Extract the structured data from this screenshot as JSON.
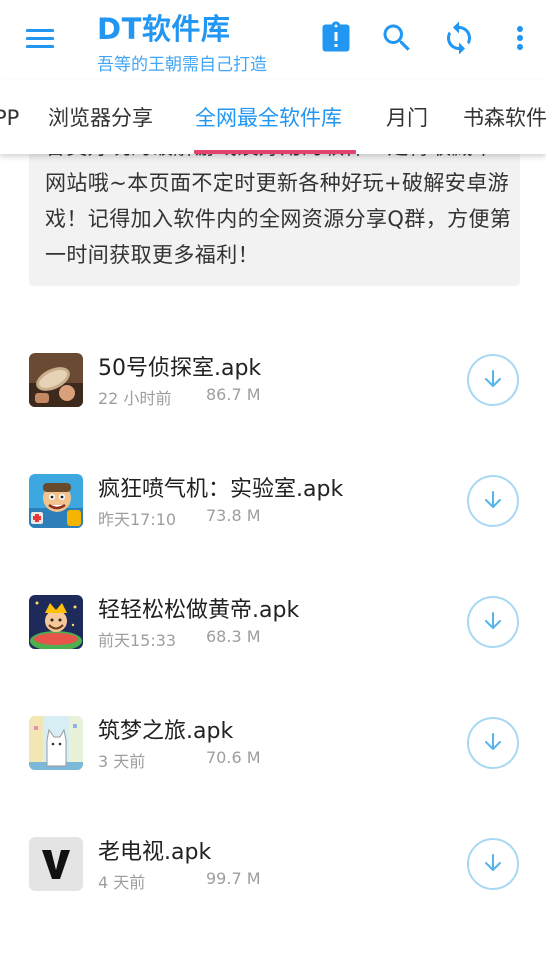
{
  "colors": {
    "primary": "#2196F3",
    "tab_indicator": "#E0436E",
    "download_circle": "#A8D8F3",
    "notice_bg": "#F2F2F2",
    "meta_text": "#9E9E9E"
  },
  "app_bar": {
    "title": "DT软件库",
    "subtitle": "吾等的王朝需自己打造",
    "icons": [
      "menu-icon",
      "clipboard-alert-icon",
      "search-icon",
      "refresh-icon",
      "more-vert-icon"
    ]
  },
  "tabs": [
    {
      "label": "PP",
      "active": false
    },
    {
      "label": "浏览器分享",
      "active": false
    },
    {
      "label": "全网最全软件库",
      "active": true
    },
    {
      "label": "月门",
      "active": false
    },
    {
      "label": "书森软件",
      "active": false
    }
  ],
  "notice": {
    "text": "各类好玩的破解游戏及好用的软件一定得收藏本网站哦~本页面不定时更新各种好玩+破解安卓游戏！记得加入软件内的全网资源分享Q群，方便第一时间获取更多福利！"
  },
  "files": [
    {
      "name": "50号侦探室.apk",
      "time": "22 小时前",
      "size": "86.7 M",
      "icon": "detective-game-icon"
    },
    {
      "name": "疯狂喷气机：实验室.apk",
      "time": "昨天17:10",
      "size": "73.8 M",
      "icon": "jetpack-game-icon"
    },
    {
      "name": "轻轻松松做黄帝.apk",
      "time": "前天15:33",
      "size": "68.3 M",
      "icon": "emperor-game-icon"
    },
    {
      "name": "筑梦之旅.apk",
      "time": "3 天前",
      "size": "70.6 M",
      "icon": "cat-game-icon"
    },
    {
      "name": "老电视.apk",
      "time": "4 天前",
      "size": "99.7 M",
      "icon": "v-letter-app-icon"
    }
  ]
}
